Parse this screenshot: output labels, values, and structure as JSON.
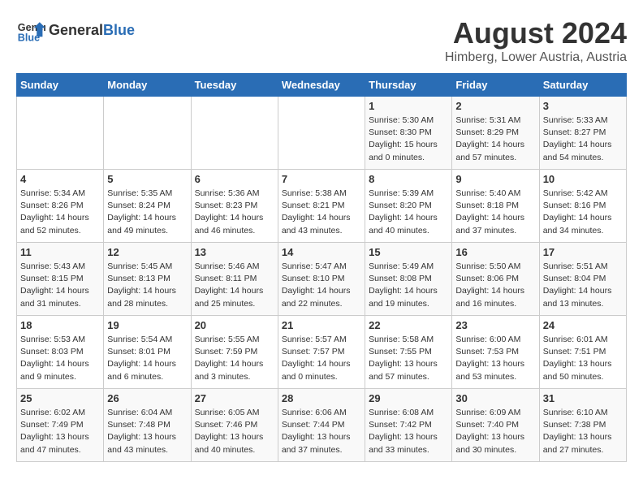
{
  "header": {
    "logo_general": "General",
    "logo_blue": "Blue",
    "month_year": "August 2024",
    "location": "Himberg, Lower Austria, Austria"
  },
  "weekdays": [
    "Sunday",
    "Monday",
    "Tuesday",
    "Wednesday",
    "Thursday",
    "Friday",
    "Saturday"
  ],
  "weeks": [
    [
      {
        "day": "",
        "info": ""
      },
      {
        "day": "",
        "info": ""
      },
      {
        "day": "",
        "info": ""
      },
      {
        "day": "",
        "info": ""
      },
      {
        "day": "1",
        "info": "Sunrise: 5:30 AM\nSunset: 8:30 PM\nDaylight: 15 hours\nand 0 minutes."
      },
      {
        "day": "2",
        "info": "Sunrise: 5:31 AM\nSunset: 8:29 PM\nDaylight: 14 hours\nand 57 minutes."
      },
      {
        "day": "3",
        "info": "Sunrise: 5:33 AM\nSunset: 8:27 PM\nDaylight: 14 hours\nand 54 minutes."
      }
    ],
    [
      {
        "day": "4",
        "info": "Sunrise: 5:34 AM\nSunset: 8:26 PM\nDaylight: 14 hours\nand 52 minutes."
      },
      {
        "day": "5",
        "info": "Sunrise: 5:35 AM\nSunset: 8:24 PM\nDaylight: 14 hours\nand 49 minutes."
      },
      {
        "day": "6",
        "info": "Sunrise: 5:36 AM\nSunset: 8:23 PM\nDaylight: 14 hours\nand 46 minutes."
      },
      {
        "day": "7",
        "info": "Sunrise: 5:38 AM\nSunset: 8:21 PM\nDaylight: 14 hours\nand 43 minutes."
      },
      {
        "day": "8",
        "info": "Sunrise: 5:39 AM\nSunset: 8:20 PM\nDaylight: 14 hours\nand 40 minutes."
      },
      {
        "day": "9",
        "info": "Sunrise: 5:40 AM\nSunset: 8:18 PM\nDaylight: 14 hours\nand 37 minutes."
      },
      {
        "day": "10",
        "info": "Sunrise: 5:42 AM\nSunset: 8:16 PM\nDaylight: 14 hours\nand 34 minutes."
      }
    ],
    [
      {
        "day": "11",
        "info": "Sunrise: 5:43 AM\nSunset: 8:15 PM\nDaylight: 14 hours\nand 31 minutes."
      },
      {
        "day": "12",
        "info": "Sunrise: 5:45 AM\nSunset: 8:13 PM\nDaylight: 14 hours\nand 28 minutes."
      },
      {
        "day": "13",
        "info": "Sunrise: 5:46 AM\nSunset: 8:11 PM\nDaylight: 14 hours\nand 25 minutes."
      },
      {
        "day": "14",
        "info": "Sunrise: 5:47 AM\nSunset: 8:10 PM\nDaylight: 14 hours\nand 22 minutes."
      },
      {
        "day": "15",
        "info": "Sunrise: 5:49 AM\nSunset: 8:08 PM\nDaylight: 14 hours\nand 19 minutes."
      },
      {
        "day": "16",
        "info": "Sunrise: 5:50 AM\nSunset: 8:06 PM\nDaylight: 14 hours\nand 16 minutes."
      },
      {
        "day": "17",
        "info": "Sunrise: 5:51 AM\nSunset: 8:04 PM\nDaylight: 14 hours\nand 13 minutes."
      }
    ],
    [
      {
        "day": "18",
        "info": "Sunrise: 5:53 AM\nSunset: 8:03 PM\nDaylight: 14 hours\nand 9 minutes."
      },
      {
        "day": "19",
        "info": "Sunrise: 5:54 AM\nSunset: 8:01 PM\nDaylight: 14 hours\nand 6 minutes."
      },
      {
        "day": "20",
        "info": "Sunrise: 5:55 AM\nSunset: 7:59 PM\nDaylight: 14 hours\nand 3 minutes."
      },
      {
        "day": "21",
        "info": "Sunrise: 5:57 AM\nSunset: 7:57 PM\nDaylight: 14 hours\nand 0 minutes."
      },
      {
        "day": "22",
        "info": "Sunrise: 5:58 AM\nSunset: 7:55 PM\nDaylight: 13 hours\nand 57 minutes."
      },
      {
        "day": "23",
        "info": "Sunrise: 6:00 AM\nSunset: 7:53 PM\nDaylight: 13 hours\nand 53 minutes."
      },
      {
        "day": "24",
        "info": "Sunrise: 6:01 AM\nSunset: 7:51 PM\nDaylight: 13 hours\nand 50 minutes."
      }
    ],
    [
      {
        "day": "25",
        "info": "Sunrise: 6:02 AM\nSunset: 7:49 PM\nDaylight: 13 hours\nand 47 minutes."
      },
      {
        "day": "26",
        "info": "Sunrise: 6:04 AM\nSunset: 7:48 PM\nDaylight: 13 hours\nand 43 minutes."
      },
      {
        "day": "27",
        "info": "Sunrise: 6:05 AM\nSunset: 7:46 PM\nDaylight: 13 hours\nand 40 minutes."
      },
      {
        "day": "28",
        "info": "Sunrise: 6:06 AM\nSunset: 7:44 PM\nDaylight: 13 hours\nand 37 minutes."
      },
      {
        "day": "29",
        "info": "Sunrise: 6:08 AM\nSunset: 7:42 PM\nDaylight: 13 hours\nand 33 minutes."
      },
      {
        "day": "30",
        "info": "Sunrise: 6:09 AM\nSunset: 7:40 PM\nDaylight: 13 hours\nand 30 minutes."
      },
      {
        "day": "31",
        "info": "Sunrise: 6:10 AM\nSunset: 7:38 PM\nDaylight: 13 hours\nand 27 minutes."
      }
    ]
  ]
}
